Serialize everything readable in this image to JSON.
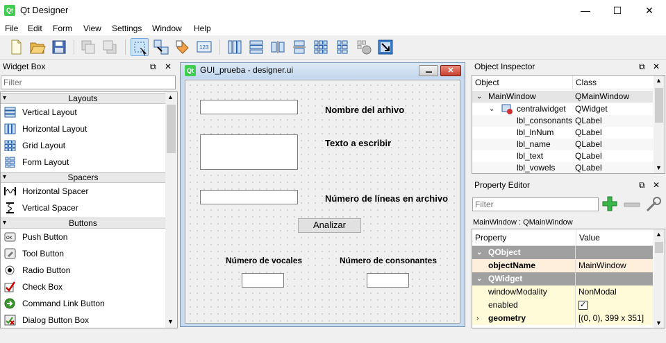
{
  "window": {
    "title": "Qt Designer",
    "logo_text": "Qt",
    "min_glyph": "—",
    "max_glyph": "☐",
    "close_glyph": "✕"
  },
  "menu": [
    "File",
    "Edit",
    "Form",
    "View",
    "Settings",
    "Window",
    "Help"
  ],
  "widget_box": {
    "title": "Widget Box",
    "filter_placeholder": "Filter",
    "float_glyph": "⧉",
    "close_glyph": "✕",
    "categories": {
      "layouts": "Layouts",
      "spacers": "Spacers",
      "buttons": "Buttons"
    },
    "layouts": [
      "Vertical Layout",
      "Horizontal Layout",
      "Grid Layout",
      "Form Layout"
    ],
    "spacers": [
      "Horizontal Spacer",
      "Vertical Spacer"
    ],
    "buttons": [
      "Push Button",
      "Tool Button",
      "Radio Button",
      "Check Box",
      "Command Link Button",
      "Dialog Button Box"
    ]
  },
  "form": {
    "title": "GUI_prueba - designer.ui",
    "logo_text": "Qt",
    "label_nombre": "Nombre del arhivo",
    "label_texto": "Texto a escribir",
    "label_lineas": "Número de líneas en archivo",
    "button_analizar": "Analizar",
    "label_vocales": "Número de vocales",
    "label_consonantes": "Número de consonantes"
  },
  "object_inspector": {
    "title": "Object Inspector",
    "col_object": "Object",
    "col_class": "Class",
    "rows": [
      {
        "object": "MainWindow",
        "class": "QMainWindow"
      },
      {
        "object": "centralwidget",
        "class": "QWidget"
      },
      {
        "object": "lbl_consonants",
        "class": "QLabel"
      },
      {
        "object": "lbl_lnNum",
        "class": "QLabel"
      },
      {
        "object": "lbl_name",
        "class": "QLabel"
      },
      {
        "object": "lbl_text",
        "class": "QLabel"
      },
      {
        "object": "lbl_vowels",
        "class": "QLabel"
      }
    ]
  },
  "property_editor": {
    "title": "Property Editor",
    "filter_placeholder": "Filter",
    "context": "MainWindow : QMainWindow",
    "col_property": "Property",
    "col_value": "Value",
    "rows": [
      {
        "property": "QObject",
        "value": ""
      },
      {
        "property": "objectName",
        "value": "MainWindow"
      },
      {
        "property": "QWidget",
        "value": ""
      },
      {
        "property": "windowModality",
        "value": "NonModal"
      },
      {
        "property": "enabled",
        "value": "✓"
      },
      {
        "property": "geometry",
        "value": "[(0, 0), 399 x 351]"
      }
    ]
  },
  "colors": {
    "qt_green": "#41cd52",
    "group_header": "#a0a0a0",
    "selection": "#cce4f7"
  }
}
